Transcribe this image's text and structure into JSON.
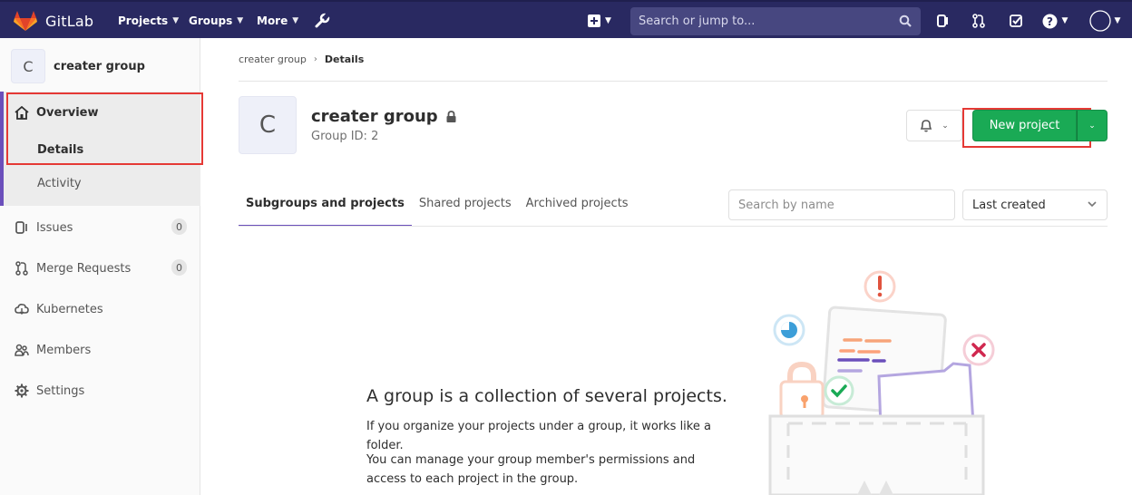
{
  "topbar": {
    "brand": "GitLab",
    "nav": [
      {
        "label": "Projects"
      },
      {
        "label": "Groups"
      },
      {
        "label": "More"
      }
    ],
    "search_placeholder": "Search or jump to...",
    "accent": "#292961"
  },
  "sidebar": {
    "avatar_letter": "C",
    "group_name": "creater group",
    "overview": "Overview",
    "details": "Details",
    "activity": "Activity",
    "items": [
      {
        "label": "Issues",
        "count": "0",
        "icon": "issues-icon"
      },
      {
        "label": "Merge Requests",
        "count": "0",
        "icon": "merge-request-icon"
      },
      {
        "label": "Kubernetes",
        "icon": "kubernetes-icon"
      },
      {
        "label": "Members",
        "icon": "members-icon"
      },
      {
        "label": "Settings",
        "icon": "settings-gear-icon"
      }
    ]
  },
  "breadcrumb": {
    "parent": "creater group",
    "current": "Details"
  },
  "group": {
    "avatar_letter": "C",
    "name": "creater group",
    "id_text": "Group ID: 2"
  },
  "actions": {
    "new_project": "New project"
  },
  "tabs": [
    {
      "label": "Subgroups and projects",
      "active": true
    },
    {
      "label": "Shared projects"
    },
    {
      "label": "Archived projects"
    }
  ],
  "filter": {
    "placeholder": "Search by name",
    "sort_value": "Last created"
  },
  "empty_state": {
    "title": "A group is a collection of several projects.",
    "p1": "If you organize your projects under a group, it works like a folder.",
    "p2": "You can manage your group member's permissions and access to each project in the group."
  },
  "colors": {
    "green": "#1aaa55",
    "purple": "#6b4fbb",
    "highlight": "#e53935"
  }
}
